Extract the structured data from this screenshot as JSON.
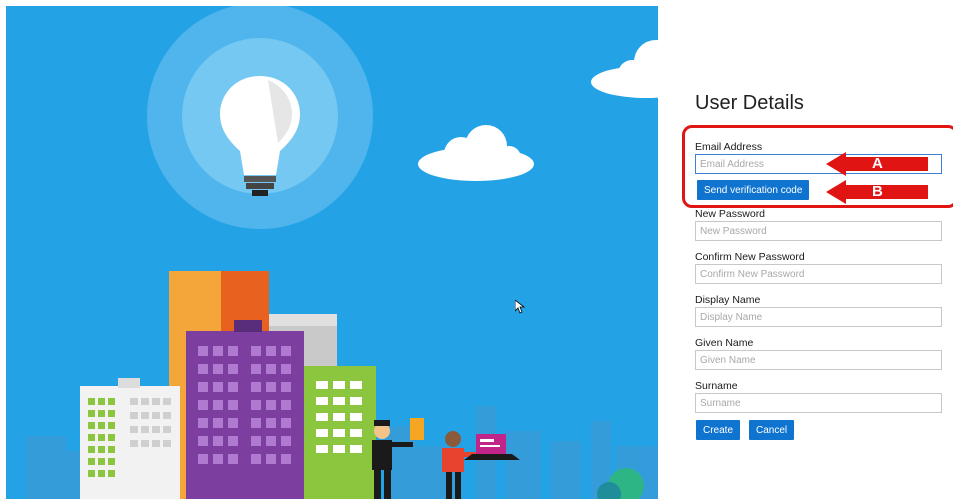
{
  "form": {
    "title": "User Details",
    "email": {
      "label": "Email Address",
      "placeholder": "Email Address",
      "value": ""
    },
    "send_code_label": "Send verification code",
    "new_password": {
      "label": "New Password",
      "placeholder": "New Password"
    },
    "confirm_password": {
      "label": "Confirm New Password",
      "placeholder": "Confirm New Password"
    },
    "display_name": {
      "label": "Display Name",
      "placeholder": "Display Name"
    },
    "given_name": {
      "label": "Given Name",
      "placeholder": "Given Name"
    },
    "surname": {
      "label": "Surname",
      "placeholder": "Surname"
    },
    "create_label": "Create",
    "cancel_label": "Cancel"
  },
  "annotations": {
    "arrow_a": "A",
    "arrow_b": "B",
    "highlight_color": "#e11414"
  },
  "theme": {
    "sky_color": "#24a2e6",
    "button_color": "#0f74cf"
  }
}
